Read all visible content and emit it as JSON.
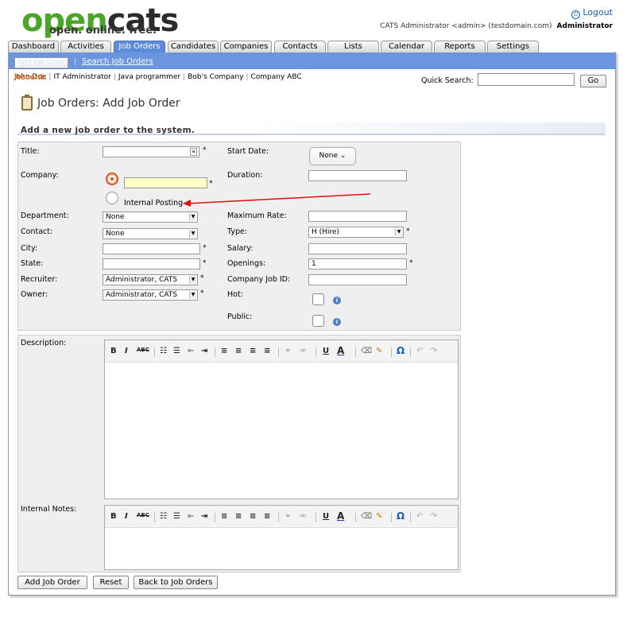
{
  "brand": {
    "logo_open": "open",
    "logo_cats": "cats",
    "tagline": "open. online. free."
  },
  "header": {
    "logout": "Logout",
    "user": "CATS Administrator <admin> (testdomain.com)",
    "role": "Administrator"
  },
  "tabs": [
    "Dashboard",
    "Activities",
    "Job Orders",
    "Candidates",
    "Companies",
    "Contacts",
    "Lists",
    "Calendar",
    "Reports",
    "Settings"
  ],
  "subnav": {
    "add": "Add Job Order",
    "search": "Search Job Orders",
    "sep": "|"
  },
  "recent": {
    "label": "Recent:",
    "items": [
      "John Doe",
      "IT Administrator",
      "Java programmer",
      "Bob's Company",
      "Company ABC"
    ]
  },
  "quick_search": {
    "label": "Quick Search:",
    "value": "",
    "button": "Go"
  },
  "page": {
    "title": "Job Orders: Add Job Order",
    "subtitle": "Add a new job order to the system."
  },
  "form": {
    "title": {
      "label": "Title:",
      "value": ""
    },
    "company": {
      "label": "Company:",
      "value": "",
      "internal_label": "Internal Posting"
    },
    "department": {
      "label": "Department:",
      "value": "None"
    },
    "contact": {
      "label": "Contact:",
      "value": "None"
    },
    "city": {
      "label": "City:",
      "value": ""
    },
    "state": {
      "label": "State:",
      "value": ""
    },
    "recruiter": {
      "label": "Recruiter:",
      "value": "Administrator, CATS"
    },
    "owner": {
      "label": "Owner:",
      "value": "Administrator, CATS"
    },
    "start_date": {
      "label": "Start Date:",
      "value": "None"
    },
    "duration": {
      "label": "Duration:",
      "value": ""
    },
    "max_rate": {
      "label": "Maximum Rate:",
      "value": ""
    },
    "type": {
      "label": "Type:",
      "value": "H (Hire)"
    },
    "salary": {
      "label": "Salary:",
      "value": ""
    },
    "openings": {
      "label": "Openings:",
      "value": "1"
    },
    "company_job_id": {
      "label": "Company Job ID:",
      "value": ""
    },
    "hot": {
      "label": "Hot:",
      "checked": false
    },
    "public": {
      "label": "Public:",
      "checked": false
    },
    "required_mark": "*",
    "info_glyph": "i"
  },
  "description": {
    "label": "Description:"
  },
  "notes": {
    "label": "Internal Notes:"
  },
  "toolbar": {
    "bold": "B",
    "italic": "I",
    "strike": "ABC",
    "ul": "☷",
    "ol": "☰",
    "outdent": "⇤",
    "indent": "⇥",
    "left": "≡",
    "center": "≡",
    "right": "≡",
    "justify": "≡",
    "link": "⚭",
    "unlink": "⚮",
    "underline": "U",
    "color": "A",
    "eraser": "⌫",
    "brush": "✎",
    "omega": "Ω",
    "undo": "↶",
    "redo": "↷"
  },
  "buttons": {
    "add": "Add Job Order",
    "reset": "Reset",
    "back": "Back to Job Orders"
  },
  "colors": {
    "nav_blue": "#6b96df",
    "tab_active": "#5e8bd8",
    "brand_green": "#4aa628",
    "accent_orange": "#e0702a",
    "arrow_red": "#dd1111"
  }
}
